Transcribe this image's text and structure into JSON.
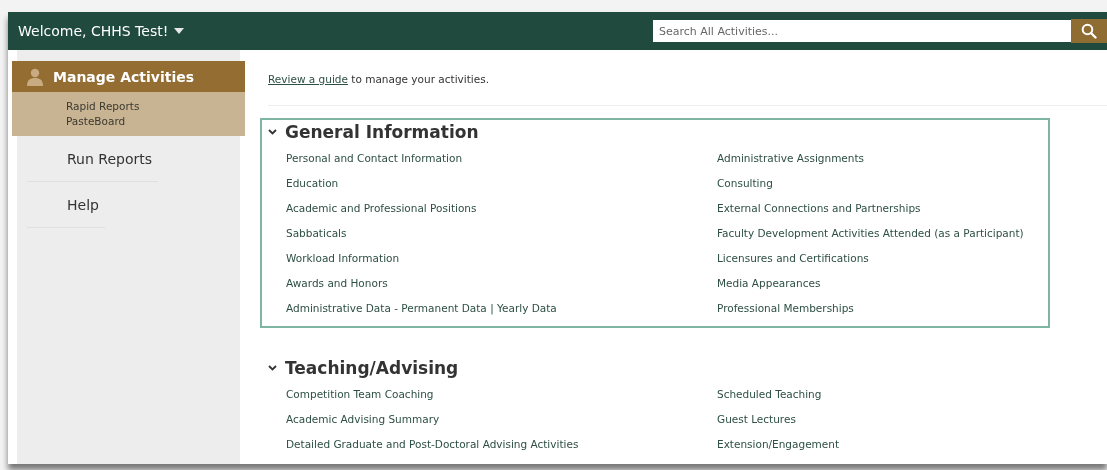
{
  "header": {
    "welcome": "Welcome, CHHS Test!",
    "search": {
      "placeholder": "Search All Activities..."
    }
  },
  "sidebar": {
    "items": [
      {
        "label": "Manage Activities",
        "selected": true,
        "expanded": true,
        "children": [
          {
            "label": "Rapid Reports"
          },
          {
            "label": "PasteBoard"
          }
        ]
      },
      {
        "label": "Run Reports",
        "selected": false
      },
      {
        "label": "Help",
        "selected": false
      }
    ]
  },
  "intro": {
    "link": "Review a guide",
    "text": " to manage your activities."
  },
  "sections": [
    {
      "title": "General Information",
      "expanded": true,
      "focused": true,
      "columns": [
        [
          "Personal and Contact Information",
          "Education",
          "Academic and Professional Positions",
          "Sabbaticals",
          "Workload Information",
          "Awards and Honors",
          "Administrative Data - Permanent Data | Yearly Data"
        ],
        [
          "Administrative Assignments",
          "Consulting",
          "External Connections and Partnerships",
          "Faculty Development Activities Attended (as a Participant)",
          "Licensures and Certifications",
          "Media Appearances",
          "Professional Memberships"
        ]
      ]
    },
    {
      "title": "Teaching/Advising",
      "expanded": true,
      "focused": false,
      "columns": [
        [
          "Competition Team Coaching",
          "Academic Advising Summary",
          "Detailed Graduate and Post-Doctoral Advising Activities"
        ],
        [
          "Scheduled Teaching",
          "Guest Lectures",
          "Extension/Engagement"
        ]
      ]
    }
  ]
}
